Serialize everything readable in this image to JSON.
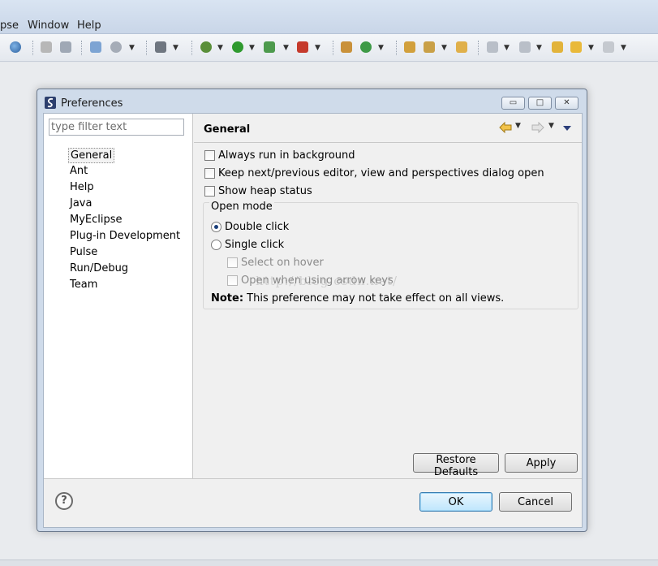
{
  "menubar": {
    "items": [
      "pse",
      "Window",
      "Help"
    ]
  },
  "toolbar": {
    "icons": [
      "globe-icon",
      "print-icon",
      "refresh-icon",
      "new-project-icon",
      "web-icon",
      "camera-icon",
      "debug-icon",
      "run-icon",
      "run-config-icon",
      "stop-icon",
      "new-package-icon",
      "new-class-icon",
      "open-type-icon",
      "wizard-icon",
      "open-folder-icon",
      "next-annotation-icon",
      "prev-annotation-icon",
      "last-edit-icon",
      "back-icon",
      "forward-icon"
    ]
  },
  "dialog": {
    "title": "Preferences",
    "minimize": "▭",
    "maximize": "□",
    "close": "✕"
  },
  "tree": {
    "filter_placeholder": "type filter text",
    "filter_value": "",
    "items": [
      {
        "label": "General",
        "selected": true
      },
      {
        "label": "Ant"
      },
      {
        "label": "Help"
      },
      {
        "label": "Java"
      },
      {
        "label": "MyEclipse"
      },
      {
        "label": "Plug-in Development"
      },
      {
        "label": "Pulse"
      },
      {
        "label": "Run/Debug"
      },
      {
        "label": "Team"
      }
    ]
  },
  "page": {
    "title": "General",
    "options": {
      "always_run_background": "Always run in background",
      "keep_next_prev": "Keep next/previous editor, view and perspectives dialog open",
      "show_heap": "Show heap status"
    },
    "open_mode": {
      "label": "Open mode",
      "double_click": "Double click",
      "single_click": "Single click",
      "select_on_hover": "Select on hover",
      "open_arrow_keys": "Open when using arrow keys",
      "selected": "double_click"
    },
    "note_label": "Note:",
    "note_text": " This preference may not take effect on all views.",
    "watermark": "http://blog.csdn.net/",
    "restore_defaults": "Restore Defaults",
    "apply": "Apply"
  },
  "footer": {
    "help": "?",
    "ok": "OK",
    "cancel": "Cancel"
  },
  "colors": {
    "dialog_frame": "#cfdbea",
    "accent": "#3c7fb1",
    "radio_dot": "#1b3f7a"
  }
}
